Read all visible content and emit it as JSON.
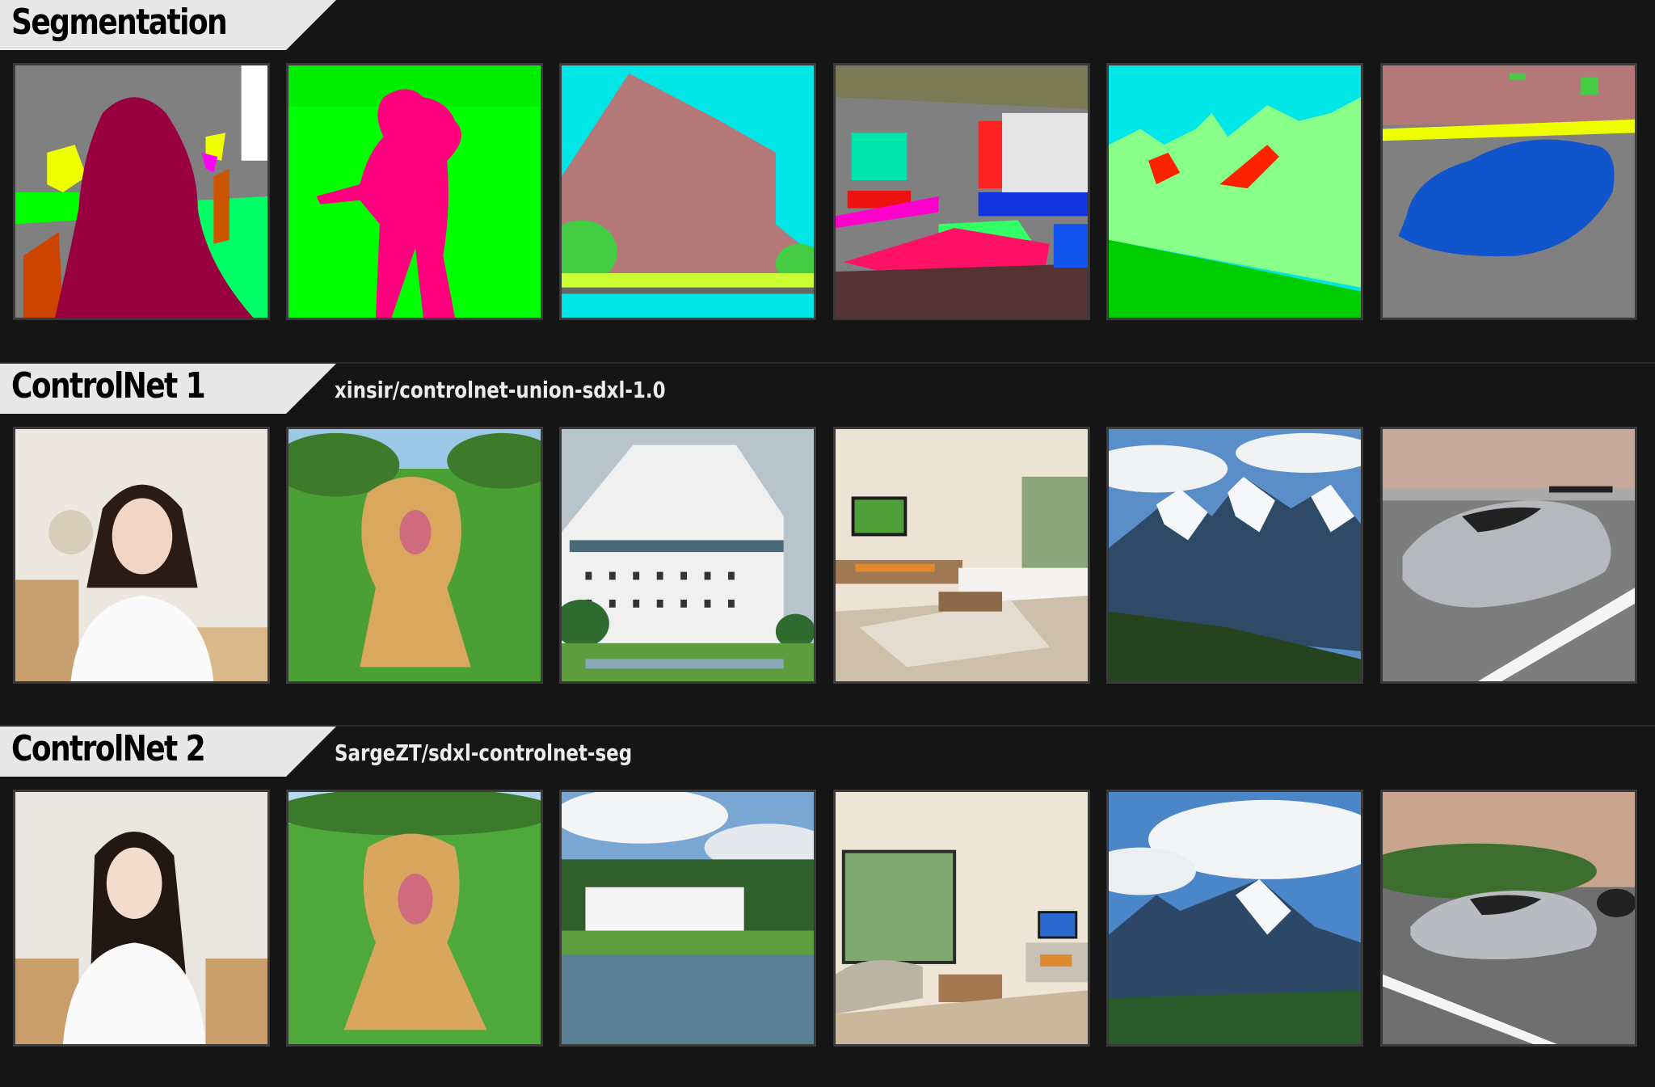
{
  "sections": [
    {
      "title": "Segmentation",
      "subtitle": ""
    },
    {
      "title": "ControlNet 1",
      "subtitle": "xinsir/controlnet-union-sdxl-1.0"
    },
    {
      "title": "ControlNet 2",
      "subtitle": "SargeZT/sdxl-controlnet-seg"
    }
  ],
  "rows": [
    {
      "row": "segmentation",
      "tiles": [
        "woman-segmentation-map",
        "dog-segmentation-map",
        "building-segmentation-map",
        "living-room-segmentation-map",
        "mountains-segmentation-map",
        "car-street-segmentation-map"
      ]
    },
    {
      "row": "controlnet-1",
      "tiles": [
        "woman-photo",
        "dog-photo",
        "building-photo",
        "living-room-photo",
        "mountains-photo",
        "car-street-photo"
      ]
    },
    {
      "row": "controlnet-2",
      "tiles": [
        "woman-photo",
        "dog-photo",
        "building-photo",
        "living-room-photo",
        "mountains-photo",
        "car-street-photo"
      ]
    }
  ],
  "colors": {
    "background": "#151515",
    "header_tab": "#e8e8e8",
    "seg_red": "#990040",
    "seg_green": "#00ff00",
    "seg_pink": "#ff007f",
    "seg_cyan": "#00e5e5",
    "seg_brown": "#b47878",
    "seg_blue": "#0066cc",
    "seg_gray": "#808080"
  }
}
